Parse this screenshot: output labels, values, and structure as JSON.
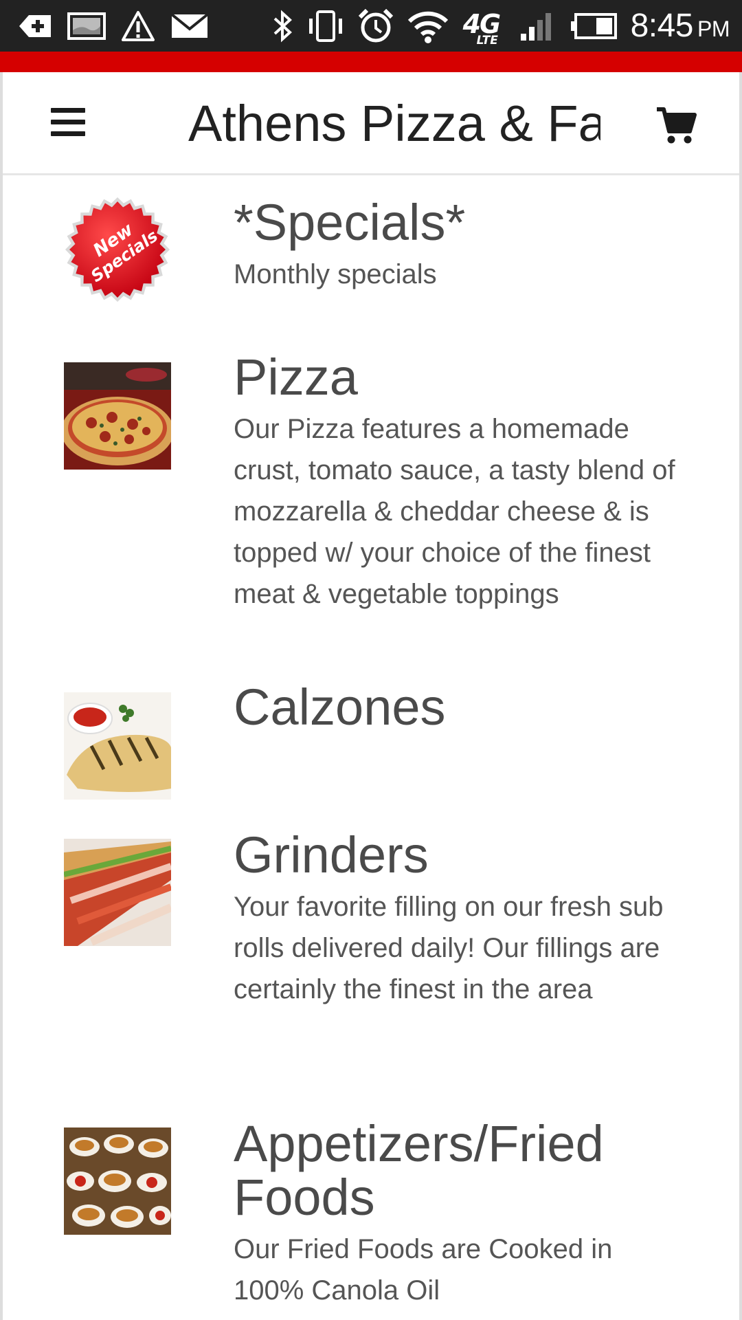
{
  "status_bar": {
    "time": "8:45",
    "ampm": "PM",
    "network_top": "4G",
    "network_bottom": "LTE",
    "icons": [
      "add-notification-icon",
      "image-notification-icon",
      "warning-icon",
      "mail-icon",
      "bluetooth-icon",
      "vibrate-icon",
      "alarm-icon",
      "wifi-icon",
      "signal-icon",
      "battery-icon"
    ]
  },
  "header": {
    "title": "Athens Pizza & Fa",
    "menu_icon": "hamburger-menu-icon",
    "cart_icon": "shopping-cart-icon"
  },
  "colors": {
    "accent": "#d50000",
    "status_bar": "#222222",
    "text": "#4a4a4a"
  },
  "categories": [
    {
      "name": "*Specials*",
      "description": "Monthly specials",
      "badge_line1": "New",
      "badge_line2": "Specials"
    },
    {
      "name": "Pizza",
      "description": "Our Pizza features a homemade crust, tomato sauce, a tasty blend of mozzarella & cheddar cheese & is topped w/ your choice of the finest meat & vegetable toppings"
    },
    {
      "name": "Calzones",
      "description": ""
    },
    {
      "name": "Grinders",
      "description": "Your favorite filling on our fresh sub rolls delivered daily! Our fillings are certainly the finest in the area"
    },
    {
      "name": "Appetizers/Fried Foods",
      "description": "Our Fried Foods are Cooked in 100% Canola Oil"
    }
  ]
}
